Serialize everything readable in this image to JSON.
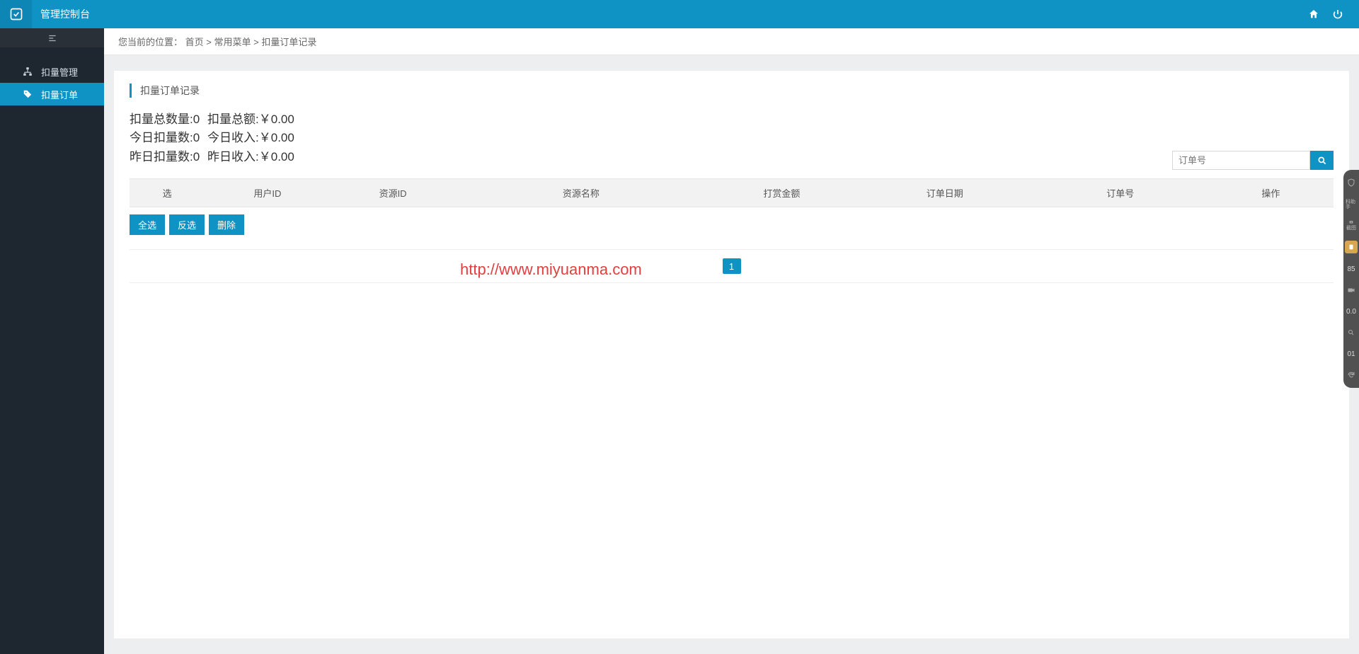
{
  "header": {
    "title": "管理控制台"
  },
  "sidebar": {
    "items": [
      {
        "label": "扣量管理",
        "icon": "sitemap"
      },
      {
        "label": "扣量订单",
        "icon": "tag"
      }
    ]
  },
  "breadcrumb": {
    "prefix": "您当前的位置：",
    "home": "首页",
    "sep": " > ",
    "mid": "常用菜单",
    "last": "扣量订单记录"
  },
  "panel": {
    "title": "扣量订单记录"
  },
  "stats": {
    "total_count_label": "扣量总数量:",
    "total_count_value": "0",
    "total_amount_label": "扣量总额:",
    "total_amount_value": "￥0.00",
    "today_count_label": "今日扣量数:",
    "today_count_value": "0",
    "today_income_label": "今日收入:",
    "today_income_value": "￥0.00",
    "yest_count_label": "昨日扣量数:",
    "yest_count_value": "0",
    "yest_income_label": "昨日收入:",
    "yest_income_value": "￥0.00"
  },
  "search": {
    "placeholder": "订单号"
  },
  "table": {
    "headers": [
      "选",
      "用户ID",
      "资源ID",
      "资源名称",
      "打赏金额",
      "订单日期",
      "订单号",
      "操作"
    ]
  },
  "actions": {
    "select_all": "全选",
    "invert": "反选",
    "delete": "删除"
  },
  "pagination": {
    "current": "1"
  },
  "watermark": "http://www.miyuanma.com",
  "side_widget": {
    "num1": "85",
    "num2": "0.0",
    "num3": "01"
  }
}
